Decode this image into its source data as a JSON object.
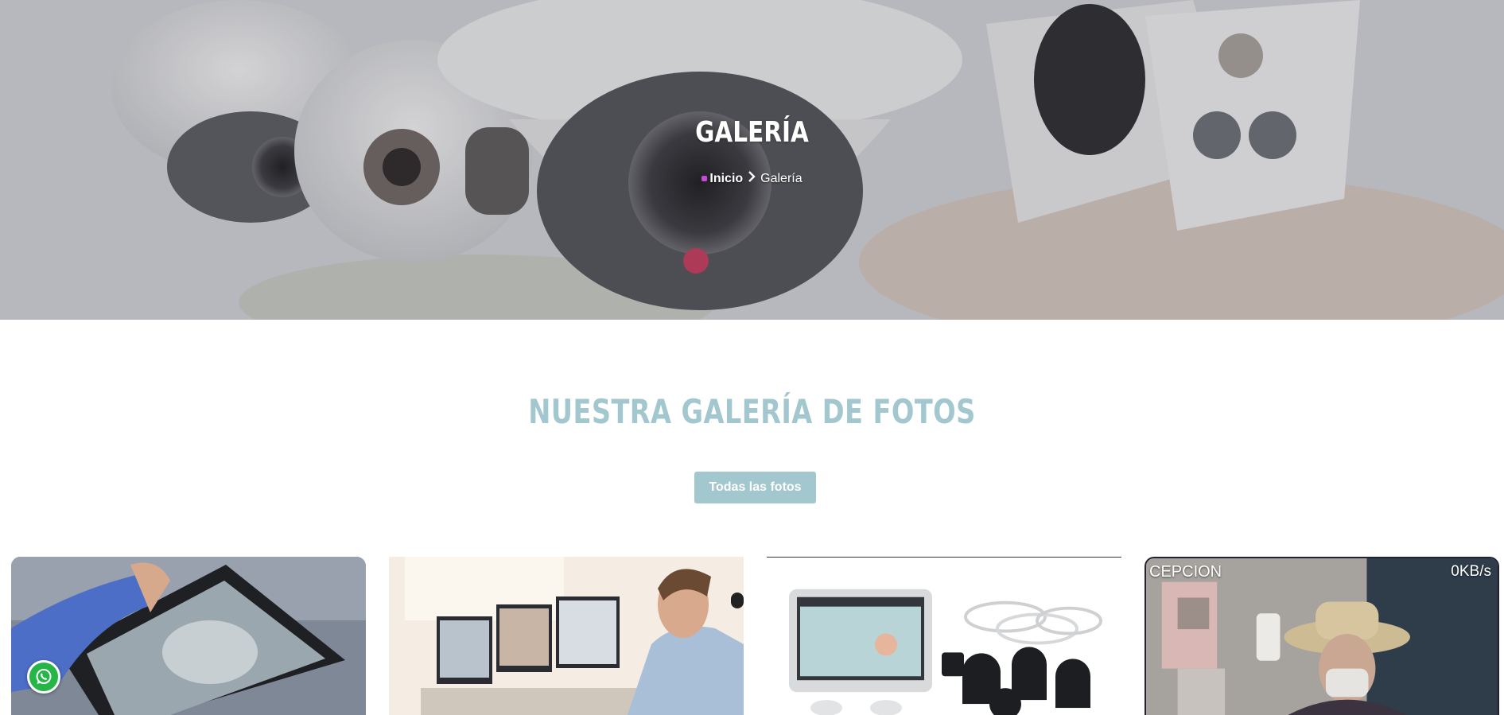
{
  "hero": {
    "title": "GALERÍA",
    "breadcrumb": {
      "home": "Inicio",
      "separator": "›",
      "current": "Galería"
    }
  },
  "gallery_section": {
    "title": "NUESTRA GALERÍA DE FOTOS",
    "filter_button": "Todas las fotos",
    "items": [
      {
        "subject": "hand holding tablet with surveillance view"
      },
      {
        "subject": "man at multi-monitor workstation"
      },
      {
        "subject": "camera kit with monitor and dome cameras"
      },
      {
        "subject": "cctv still frame",
        "overlay_left": "CEPCION",
        "overlay_right": "0KB/s"
      }
    ]
  },
  "colors": {
    "accent": "#a3c7ce",
    "whatsapp": "#26b547"
  },
  "icons": {
    "breadcrumb_separator": "chevron-right-icon",
    "floating": "whatsapp-icon"
  }
}
